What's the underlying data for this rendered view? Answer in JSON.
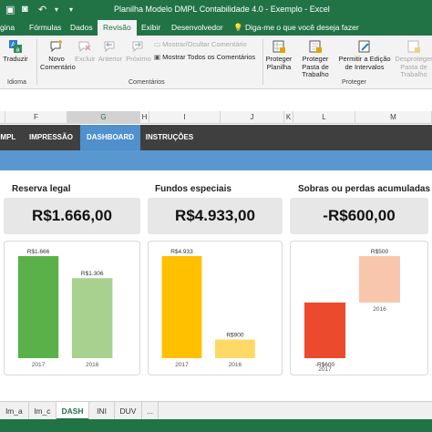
{
  "window": {
    "title": "Planilha Modelo DMPL Contabilidade 4.0 - Exemplo  -  Excel"
  },
  "ribbon_tabs": [
    "gina",
    "Fórmulas",
    "Dados",
    "Revisão",
    "Exibir",
    "Desenvolvedor"
  ],
  "tell_me": "Diga-me o que você deseja fazer",
  "ribbon": {
    "translate": "Traduzir",
    "new_comment": "Novo Comentário",
    "delete": "Excluir",
    "previous": "Anterior",
    "next": "Próximo",
    "show_hide_comment": "Mostrar/Ocultar Comentário",
    "show_all_comments": "Mostrar Todos os Comentários",
    "protect_sheet": "Proteger Planilha",
    "protect_workbook": "Proteger Pasta de Trabalho",
    "allow_edit_ranges": "Permitir a Edição de Intervalos",
    "unprotect_workbook": "Desproteger Pasta de Trabalho",
    "group_language": "Idioma",
    "group_comments": "Comentários",
    "group_protect": "Proteger"
  },
  "columns": [
    "F",
    "G",
    "H",
    "I",
    "J",
    "K",
    "L",
    "M"
  ],
  "sheet_nav": [
    "DMPL",
    "IMPRESSÃO",
    "DASHBOARD",
    "INSTRUÇÕES"
  ],
  "kpis": [
    {
      "label": "Reserva legal",
      "value": "R$1.666,00"
    },
    {
      "label": "Fundos especiais",
      "value": "R$4.933,00"
    },
    {
      "label": "Sobras ou perdas acumuladas",
      "value": "-R$600,00"
    }
  ],
  "chart_data": [
    {
      "type": "bar",
      "categories": [
        "2017",
        "2016"
      ],
      "values": [
        1666,
        1306
      ],
      "value_labels": [
        "R$1.666",
        "R$1.306"
      ],
      "colors": [
        "#5ab14a",
        "#a8d18f"
      ]
    },
    {
      "type": "bar",
      "categories": [
        "2017",
        "2016"
      ],
      "values": [
        4933,
        900
      ],
      "value_labels": [
        "R$4.933",
        "R$900"
      ],
      "colors": [
        "#ffc000",
        "#ffd966"
      ]
    },
    {
      "type": "bar",
      "categories": [
        "2017",
        "2016"
      ],
      "values": [
        -600,
        500
      ],
      "value_labels": [
        "-R$600",
        "R$500"
      ],
      "colors": [
        "#ec4a2d",
        "#f7c6ac"
      ]
    }
  ],
  "sheet_tabs": [
    "lm_a",
    "lm_c",
    "DASH",
    "INI",
    "DUV"
  ],
  "sheet_tab_extra": "..."
}
